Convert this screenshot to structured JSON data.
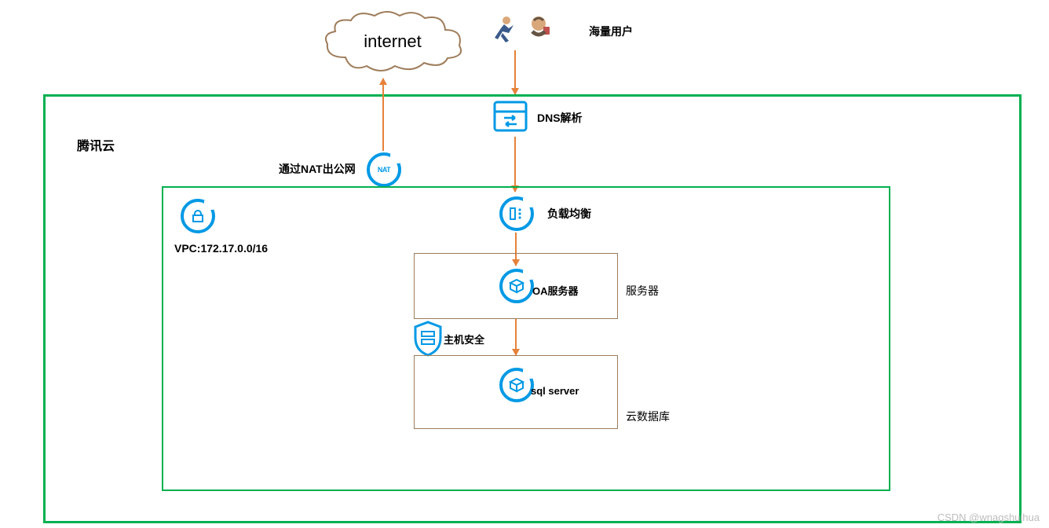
{
  "internet_cloud_label": "internet",
  "users_label": "海量用户",
  "tencent_cloud_label": "腾讯云",
  "nat_label": "通过NAT出公网",
  "nat_icon_text": "NAT",
  "dns_label": "DNS解析",
  "vpc_label": "VPC:172.17.0.0/16",
  "lb_label": "负载均衡",
  "oa_server_label": "OA服务器",
  "server_box_label": "服务器",
  "host_security_label": "主机安全",
  "sql_server_label": "sql server",
  "db_box_label": "云数据库",
  "watermark": "CSDN @wnagshuihua",
  "colors": {
    "green": "#00b050",
    "blue": "#0099e5",
    "brown": "#9e7c5a",
    "arrow": "#e6813a"
  }
}
